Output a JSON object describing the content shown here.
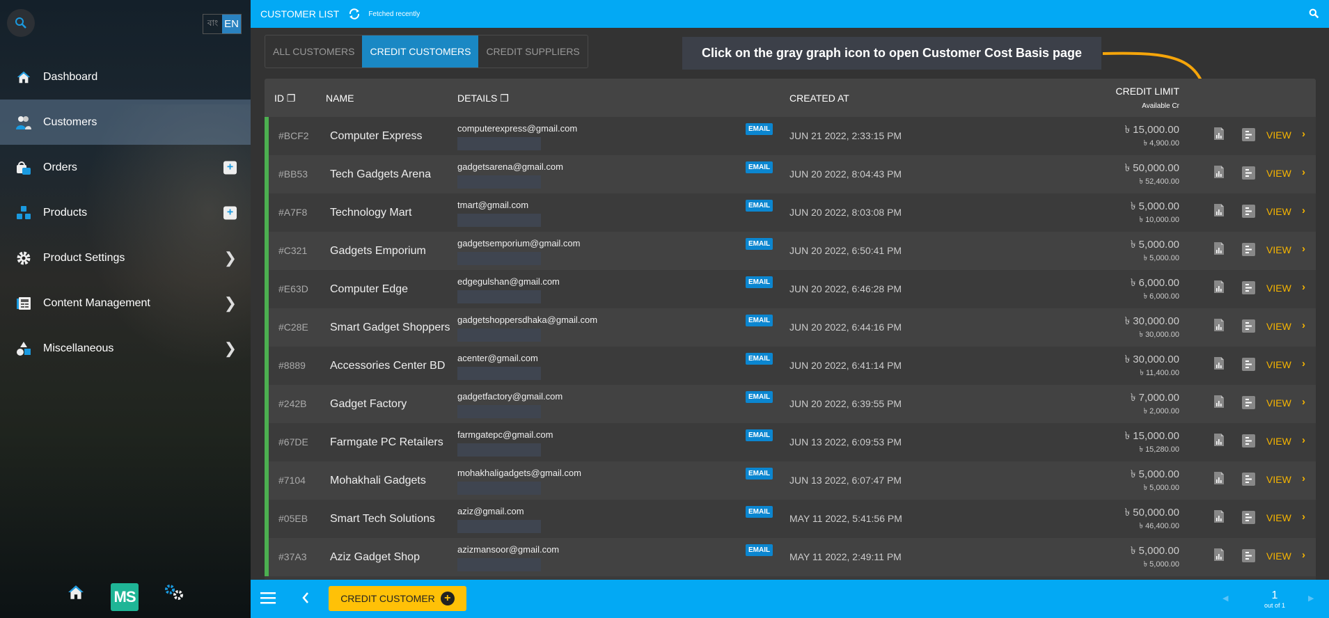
{
  "sidebar": {
    "lang": {
      "bn": "বাং",
      "en": "EN"
    },
    "items": [
      {
        "label": "Dashboard",
        "icon": "home-icon",
        "right": ""
      },
      {
        "label": "Customers",
        "icon": "users-icon",
        "right": "",
        "active": true
      },
      {
        "label": "Orders",
        "icon": "shopping-bag-icon",
        "right": "plus"
      },
      {
        "label": "Products",
        "icon": "boxes-icon",
        "right": "plus"
      },
      {
        "label": "Product Settings",
        "icon": "gear-icon",
        "right": "chevron"
      },
      {
        "label": "Content Management",
        "icon": "newspaper-icon",
        "right": "chevron"
      },
      {
        "label": "Miscellaneous",
        "icon": "shapes-icon",
        "right": "chevron"
      }
    ],
    "logo": "MS"
  },
  "header": {
    "title": "CUSTOMER LIST",
    "status": "Fetched recently"
  },
  "tabs": [
    {
      "label": "ALL CUSTOMERS"
    },
    {
      "label": "CREDIT CUSTOMERS",
      "active": true
    },
    {
      "label": "CREDIT SUPPLIERS"
    }
  ],
  "tooltip": "Click on the gray graph icon to open Customer Cost Basis page",
  "table": {
    "headers": {
      "id": "ID",
      "name": "NAME",
      "details": "DETAILS",
      "created": "CREATED AT",
      "credit": "CREDIT LIMIT",
      "available": "Available Cr"
    },
    "currency": "৳",
    "badge": "EMAIL",
    "view": "VIEW",
    "rows": [
      {
        "id": "#BCF2",
        "name": "Computer Express",
        "email": "computerexpress@gmail.com",
        "created": "JUN 21 2022, 2:33:15 PM",
        "limit": "15,000.00",
        "available": "4,900.00"
      },
      {
        "id": "#BB53",
        "name": "Tech Gadgets Arena",
        "email": "gadgetsarena@gmail.com",
        "created": "JUN 20 2022, 8:04:43 PM",
        "limit": "50,000.00",
        "available": "52,400.00"
      },
      {
        "id": "#A7F8",
        "name": "Technology Mart",
        "email": "tmart@gmail.com",
        "created": "JUN 20 2022, 8:03:08 PM",
        "limit": "5,000.00",
        "available": "10,000.00"
      },
      {
        "id": "#C321",
        "name": "Gadgets Emporium",
        "email": "gadgetsemporium@gmail.com",
        "created": "JUN 20 2022, 6:50:41 PM",
        "limit": "5,000.00",
        "available": "5,000.00"
      },
      {
        "id": "#E63D",
        "name": "Computer Edge",
        "email": "edgegulshan@gmail.com",
        "created": "JUN 20 2022, 6:46:28 PM",
        "limit": "6,000.00",
        "available": "6,000.00"
      },
      {
        "id": "#C28E",
        "name": "Smart Gadget Shoppers",
        "email": "gadgetshoppersdhaka@gmail.com",
        "created": "JUN 20 2022, 6:44:16 PM",
        "limit": "30,000.00",
        "available": "30,000.00"
      },
      {
        "id": "#8889",
        "name": "Accessories Center BD",
        "email": "acenter@gmail.com",
        "created": "JUN 20 2022, 6:41:14 PM",
        "limit": "30,000.00",
        "available": "11,400.00"
      },
      {
        "id": "#242B",
        "name": "Gadget Factory",
        "email": "gadgetfactory@gmail.com",
        "created": "JUN 20 2022, 6:39:55 PM",
        "limit": "7,000.00",
        "available": "2,000.00"
      },
      {
        "id": "#67DE",
        "name": "Farmgate PC Retailers",
        "email": "farmgatepc@gmail.com",
        "created": "JUN 13 2022, 6:09:53 PM",
        "limit": "15,000.00",
        "available": "15,280.00"
      },
      {
        "id": "#7104",
        "name": "Mohakhali Gadgets",
        "email": "mohakhaligadgets@gmail.com",
        "created": "JUN 13 2022, 6:07:47 PM",
        "limit": "5,000.00",
        "available": "5,000.00"
      },
      {
        "id": "#05EB",
        "name": "Smart Tech Solutions",
        "email": "aziz@gmail.com",
        "created": "MAY 11 2022, 5:41:56 PM",
        "limit": "50,000.00",
        "available": "46,400.00"
      },
      {
        "id": "#37A3",
        "name": "Aziz Gadget Shop",
        "email": "azizmansoor@gmail.com",
        "created": "MAY 11 2022, 2:49:11 PM",
        "limit": "5,000.00",
        "available": "5,000.00"
      }
    ]
  },
  "footer": {
    "button": "CREDIT CUSTOMER",
    "page": "1",
    "page_of": "out of 1"
  },
  "colors": {
    "accent": "#03a9f4",
    "active_tab": "#1a88c4",
    "view": "#f7b500",
    "row_marker": "#4caf50",
    "button": "#ffc107",
    "arrow": "#f5a50a"
  }
}
